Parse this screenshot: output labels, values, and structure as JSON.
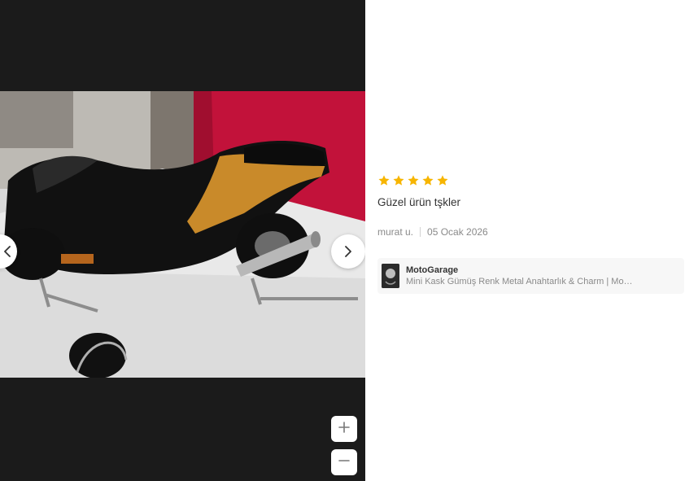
{
  "gallery": {
    "prev_icon": "chevron-left-icon",
    "next_icon": "chevron-right-icon",
    "zoom_in_icon": "plus-icon",
    "zoom_out_icon": "minus-icon",
    "background_color": "#1b1b1b"
  },
  "review": {
    "rating": 5,
    "star_color": "#f7b500",
    "comment": "Güzel ürün tşkler",
    "author": "murat u.",
    "date": "05 Ocak 2026"
  },
  "product": {
    "seller": "MotoGarage",
    "name": "Mini Kask Gümüş Renk Metal Anahtarlık & Charm | Mo…"
  }
}
